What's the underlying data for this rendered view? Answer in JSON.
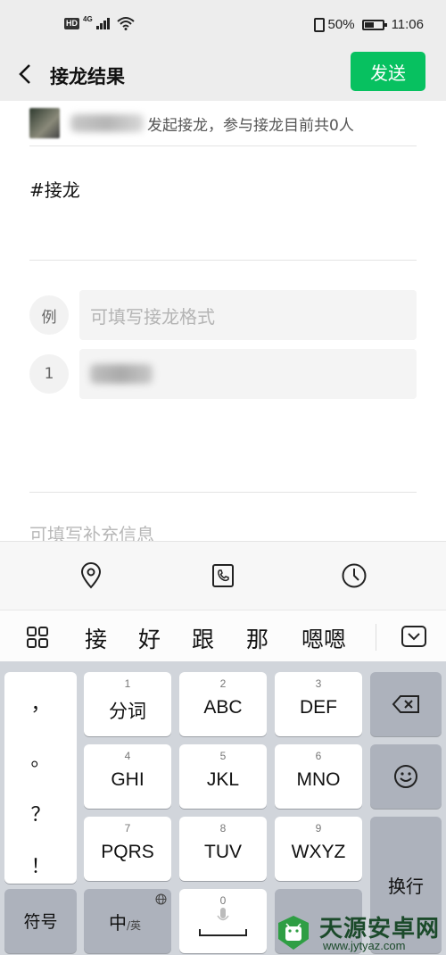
{
  "status_bar": {
    "hd_badge": "HD",
    "network": "4G",
    "battery": "50%",
    "battery_level": 0.5,
    "time": "11:06"
  },
  "header": {
    "title": "接龙结果",
    "send_label": "发送"
  },
  "content": {
    "initiator_text": "发起接龙，参与接龙目前共0人",
    "topic": "#接龙",
    "example_marker": "例",
    "example_placeholder": "可填写接龙格式",
    "entry_number": "1",
    "extra_placeholder": "可填写补充信息"
  },
  "toolbar": {
    "icons": [
      "location-icon",
      "phone-icon",
      "clock-icon"
    ]
  },
  "candidates": {
    "items": [
      "接",
      "好",
      "跟",
      "那",
      "嗯嗯"
    ]
  },
  "keyboard": {
    "punctuation": [
      "，",
      "。",
      "？",
      "！"
    ],
    "keys": [
      {
        "num": "1",
        "label": "分词"
      },
      {
        "num": "2",
        "label": "ABC"
      },
      {
        "num": "3",
        "label": "DEF"
      },
      {
        "num": "4",
        "label": "GHI"
      },
      {
        "num": "5",
        "label": "JKL"
      },
      {
        "num": "6",
        "label": "MNO"
      },
      {
        "num": "7",
        "label": "PQRS"
      },
      {
        "num": "8",
        "label": "TUV"
      },
      {
        "num": "9",
        "label": "WXYZ"
      }
    ],
    "symbol_label": "符号",
    "lang_main": "中",
    "lang_sub": "/英",
    "space_num": "0",
    "enter_label": "换行"
  },
  "watermark": {
    "name": "天源安卓网",
    "url": "www.jytyaz.com"
  },
  "colors": {
    "accent_green": "#07c160",
    "background": "#ededed",
    "keyboard_bg": "#d1d5db"
  }
}
